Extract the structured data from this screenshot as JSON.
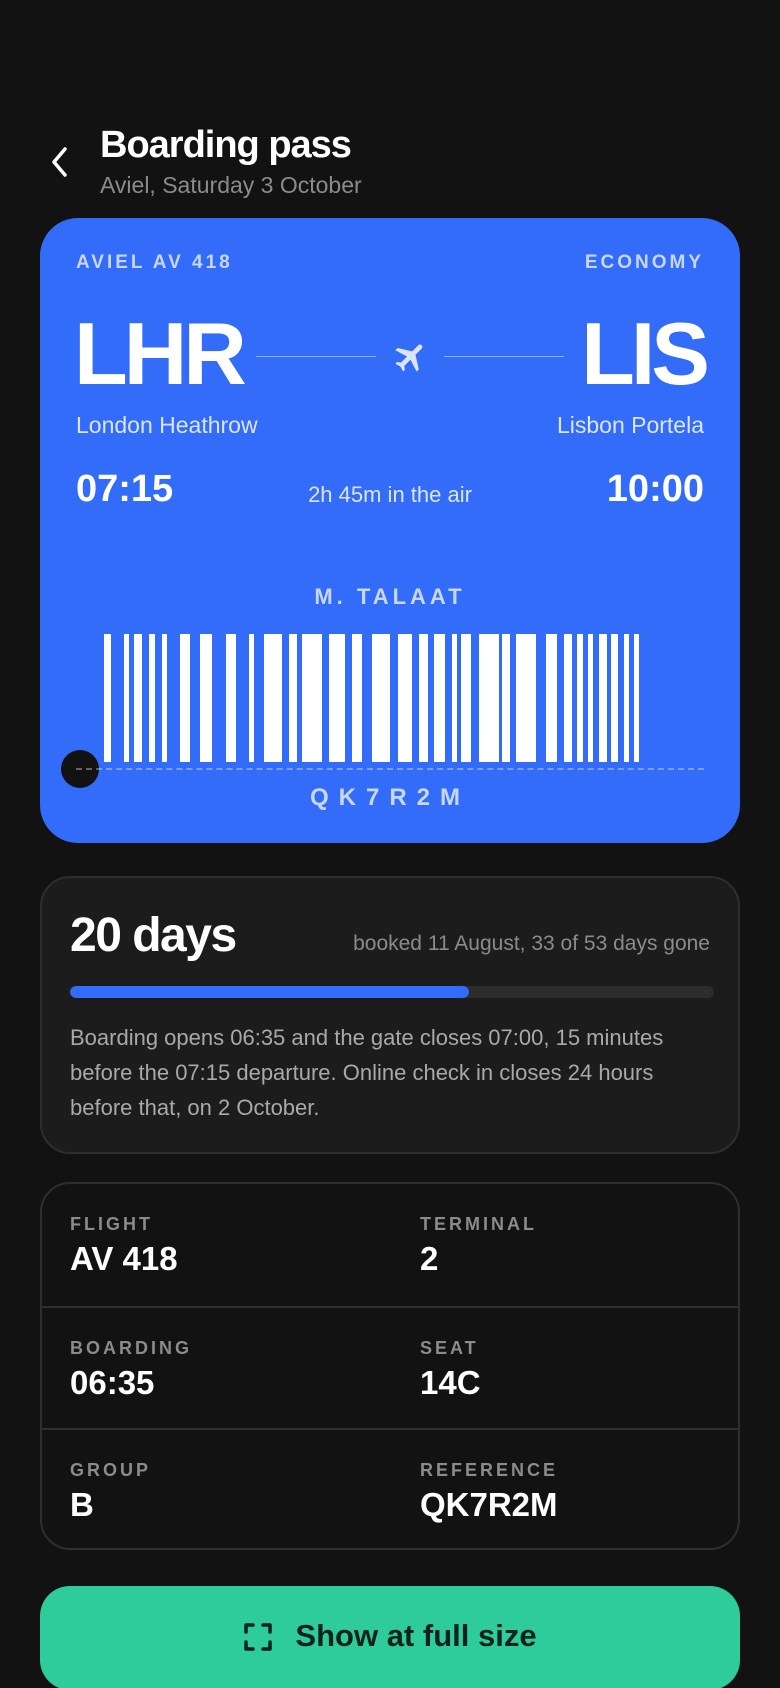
{
  "header": {
    "title": "Boarding pass",
    "subtitle": "Aviel, Saturday 3 October"
  },
  "ticket": {
    "airline": "AVIEL AV 418",
    "cabin": "ECONOMY",
    "origin": {
      "code": "LHR",
      "city": "London Heathrow",
      "time": "07:15"
    },
    "destination": {
      "code": "LIS",
      "city": "Lisbon Portela",
      "time": "10:00"
    },
    "duration": "2h 45m in the air",
    "passenger": "M. TALAAT",
    "pnr": "QK7R2M"
  },
  "countdown": {
    "days": "20 days",
    "booked": "booked 11 August, 33 of 53 days gone",
    "progress": 0.62,
    "note": "Boarding opens 06:35 and the gate closes 07:00, 15 minutes before the 07:15 departure. Online check in closes 24 hours before that, on 2 October."
  },
  "details": [
    {
      "label": "FLIGHT",
      "value": "AV 418"
    },
    {
      "label": "TERMINAL",
      "value": "2"
    },
    {
      "label": "BOARDING",
      "value": "06:35"
    },
    {
      "label": "SEAT",
      "value": "14C"
    },
    {
      "label": "GROUP",
      "value": "B"
    },
    {
      "label": "REFERENCE",
      "value": "QK7R2M"
    }
  ],
  "actions": {
    "fullsize_label": "Show at full size"
  },
  "icons": {
    "back": "chevron-left-icon",
    "plane": "airplane-icon",
    "fullsize": "expand-frame-icon"
  },
  "colors": {
    "background": "#121212",
    "ticket": "#336cf8",
    "accent": "#336cf8",
    "button": "#2ecc9a"
  }
}
